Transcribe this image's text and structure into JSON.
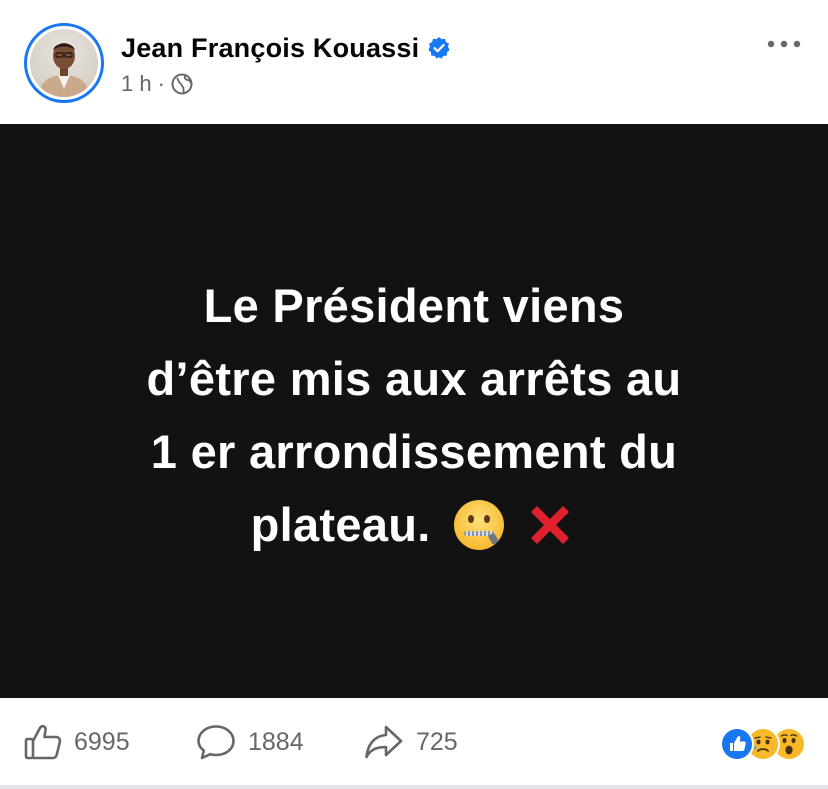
{
  "author": {
    "name": "Jean François Kouassi",
    "verified": true
  },
  "meta": {
    "time": "1 h",
    "separator": "·",
    "audience_icon": "globe-icon"
  },
  "post": {
    "text_line1": "Le Président viens",
    "text_line2": "d’être mis aux arrêts au",
    "text_line3": "1 er arrondissement du",
    "text_line4": "plateau.",
    "emojis": [
      "zipper-mouth-face-emoji",
      "cross-mark-emoji"
    ],
    "background_color": "#121212"
  },
  "footer": {
    "likes": "6995",
    "comments": "1884",
    "shares": "725",
    "reactions": [
      "like-reaction-icon",
      "sad-reaction-icon",
      "wow-reaction-icon"
    ]
  },
  "colors": {
    "accent": "#1877f2",
    "secondary_text": "#65676b",
    "cross_red": "#e0202c"
  }
}
